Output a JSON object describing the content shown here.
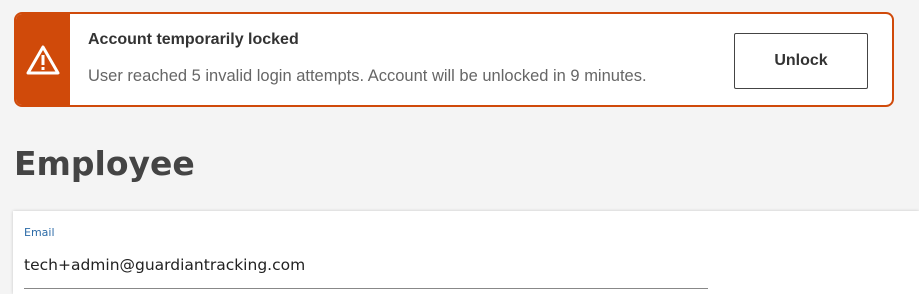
{
  "alert": {
    "title": "Account temporarily locked",
    "message": "User reached 5 invalid login attempts. Account will be unlocked in 9 minutes.",
    "icon": "warning-triangle-icon",
    "accent_color": "#d04a0a",
    "unlock_label": "Unlock"
  },
  "page": {
    "title": "Employee"
  },
  "form": {
    "email_label": "Email",
    "email_value": "tech+admin@guardiantracking.com",
    "label_color": "#2d6ca8"
  }
}
